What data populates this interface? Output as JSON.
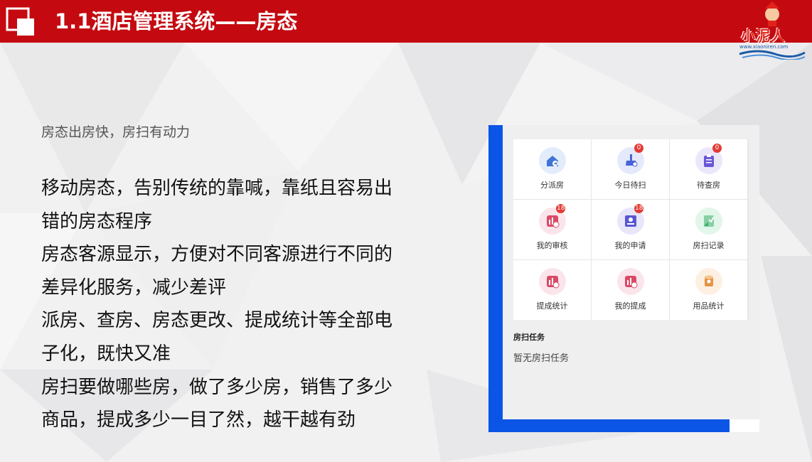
{
  "header": {
    "title": "1.1酒店管理系统——房态",
    "brand_text": "小泥人",
    "brand_url": "www.xiaoniren.com",
    "bg_color": "#c40a10"
  },
  "content": {
    "subtitle": "房态出房快，房扫有动力",
    "lines": [
      "移动房态，告别传统的靠喊，靠纸且容易出",
      "错的房态程序",
      "房态客源显示，方便对不同客源进行不同的",
      "差异化服务，减少差评",
      "派房、查房、房态更改、提成统计等全部电",
      "子化，既快又准",
      "房扫要做哪些房，做了多少房，销售了多少",
      "商品，提成多少一目了然，越干越有劲"
    ]
  },
  "phone": {
    "frame_color": "#0a55e6",
    "grid": [
      {
        "label": "分派房",
        "icon": "house-arrow-icon",
        "badge": null,
        "bg": "#e3ecfb",
        "fg": "#3e74d6"
      },
      {
        "label": "今日待扫",
        "icon": "broom-icon",
        "badge": "0",
        "bg": "#e4e9fb",
        "fg": "#4a63d8"
      },
      {
        "label": "待查房",
        "icon": "clipboard-icon",
        "badge": "0",
        "bg": "#ebe7fb",
        "fg": "#6a57d6"
      },
      {
        "label": "我的审核",
        "icon": "chart-coin-icon",
        "badge": "18",
        "bg": "#fbe5ea",
        "fg": "#d94a67"
      },
      {
        "label": "我的申请",
        "icon": "id-card-icon",
        "badge": "18",
        "bg": "#e7e6fb",
        "fg": "#5a56d2"
      },
      {
        "label": "房扫记录",
        "icon": "mop-icon",
        "badge": null,
        "bg": "#e2f6ea",
        "fg": "#3cae6a"
      },
      {
        "label": "提成统计",
        "icon": "chart-coin-icon",
        "badge": null,
        "bg": "#fbe5ea",
        "fg": "#d94a67"
      },
      {
        "label": "我的提成",
        "icon": "chart-coin-icon",
        "badge": null,
        "bg": "#fbe5ea",
        "fg": "#d94a67"
      },
      {
        "label": "用品统计",
        "icon": "paper-roll-icon",
        "badge": null,
        "bg": "#fdf0e2",
        "fg": "#e59447"
      }
    ],
    "task_title": "房扫任务",
    "task_empty": "暂无房扫任务"
  }
}
